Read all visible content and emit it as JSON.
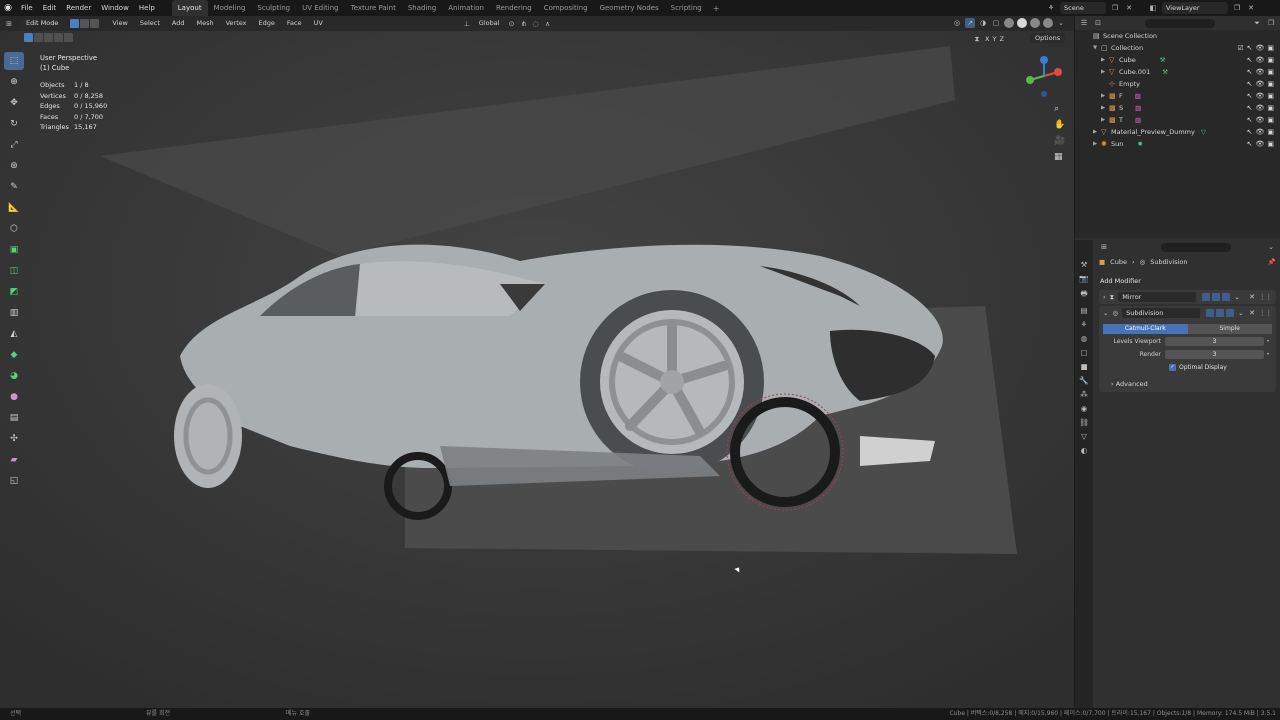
{
  "topbar": {
    "menus": [
      "File",
      "Edit",
      "Render",
      "Window",
      "Help"
    ],
    "workspaces": [
      "Layout",
      "Modeling",
      "Sculpting",
      "UV Editing",
      "Texture Paint",
      "Shading",
      "Animation",
      "Rendering",
      "Compositing",
      "Geometry Nodes",
      "Scripting"
    ],
    "active_workspace": "Layout",
    "scene": "Scene",
    "view_layer": "ViewLayer"
  },
  "viewport": {
    "mode": "Edit Mode",
    "header_menus": [
      "View",
      "Select",
      "Add",
      "Mesh",
      "Vertex",
      "Edge",
      "Face",
      "UV"
    ],
    "transform_orientation": "Global",
    "axes": [
      "X",
      "Y",
      "Z"
    ],
    "options_label": "Options",
    "view_name": "User Perspective",
    "object_name": "(1) Cube",
    "stats": [
      {
        "key": "Objects",
        "value": "1 / 8"
      },
      {
        "key": "Vertices",
        "value": "0 / 8,258"
      },
      {
        "key": "Edges",
        "value": "0 / 15,960"
      },
      {
        "key": "Faces",
        "value": "0 / 7,700"
      },
      {
        "key": "Triangles",
        "value": "15,167"
      }
    ]
  },
  "outliner": {
    "root": "Scene Collection",
    "collection": "Collection",
    "items": [
      {
        "name": "Cube",
        "icon": "mesh-object-icon"
      },
      {
        "name": "Cube.001",
        "icon": "mesh-object-icon"
      },
      {
        "name": "Empty",
        "icon": "empty-object-icon"
      },
      {
        "name": "F",
        "icon": "image-object-icon"
      },
      {
        "name": "S",
        "icon": "image-object-icon"
      },
      {
        "name": "T",
        "icon": "image-object-icon"
      }
    ],
    "extra_items": [
      {
        "name": "Material_Preview_Dummy",
        "icon": "mesh-object-icon"
      },
      {
        "name": "Sun",
        "icon": "light-object-icon"
      }
    ]
  },
  "properties": {
    "breadcrumb_object": "Cube",
    "breadcrumb_modifier": "Subdivision",
    "add_modifier": "Add Modifier",
    "modifiers": [
      {
        "name": "Mirror",
        "expanded": false
      },
      {
        "name": "Subdivision",
        "expanded": true
      }
    ],
    "subdivision": {
      "type_options": [
        "Catmull-Clark",
        "Simple"
      ],
      "selected_type": "Catmull-Clark",
      "levels_viewport_label": "Levels Viewport",
      "levels_viewport": "3",
      "render_label": "Render",
      "render": "3",
      "optimal_display_label": "Optimal Display",
      "optimal_display": true,
      "advanced_label": "Advanced"
    }
  },
  "statusbar": {
    "left": "선택",
    "mid1": "뷰를 회전",
    "mid2": "메뉴 호출",
    "right": "Cube | 버텍스:0/8,258 | 에지:0/15,960 | 페이스:0/7,700 | 트라이:15,167 | Objects:1/8 | Memory: 174.5 MiB | 3.5.1"
  },
  "colors": {
    "accent": "#4772b3",
    "active_tool": "#4a6a96",
    "object_orange": "#e39a4d",
    "modifier_green": "#56c07f"
  }
}
